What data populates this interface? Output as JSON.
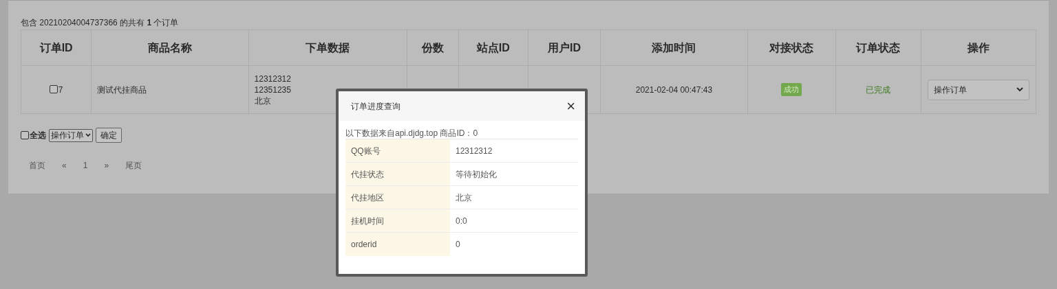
{
  "summary": "包含 20210204004737366 的共有 **1** 个订单",
  "table": {
    "columns": [
      "订单ID",
      "商品名称",
      "下单数据",
      "份数",
      "站点ID",
      "用户ID",
      "添加时间",
      "对接状态",
      "订单状态",
      "操作"
    ],
    "rows": [
      {
        "checked": false,
        "order_id": "7",
        "product": "测试代挂商品",
        "order_data": [
          "12312312",
          "12351235",
          "北京"
        ],
        "added": "2021-02-04 00:47:43",
        "sync_status": "成功",
        "order_status": "已完成",
        "action": "操作订单"
      }
    ]
  },
  "bulk": {
    "select_all": {
      "label": "全选",
      "checked": false
    },
    "action": "操作订单",
    "confirm": "确定"
  },
  "pagination": [
    "首页",
    "«",
    "1",
    "»",
    "尾页"
  ],
  "modal": {
    "title": "订单进度查询",
    "close": "×",
    "source": "以下数据来自api.djdg.top 商品ID：0",
    "rows": [
      {
        "label": "QQ账号",
        "value": "12312312"
      },
      {
        "label": "代挂状态",
        "value": "等待初始化"
      },
      {
        "label": "代挂地区",
        "value": "北京"
      },
      {
        "label": "挂机时间",
        "value": "0:0"
      },
      {
        "label": "orderid",
        "value": "0"
      }
    ]
  }
}
